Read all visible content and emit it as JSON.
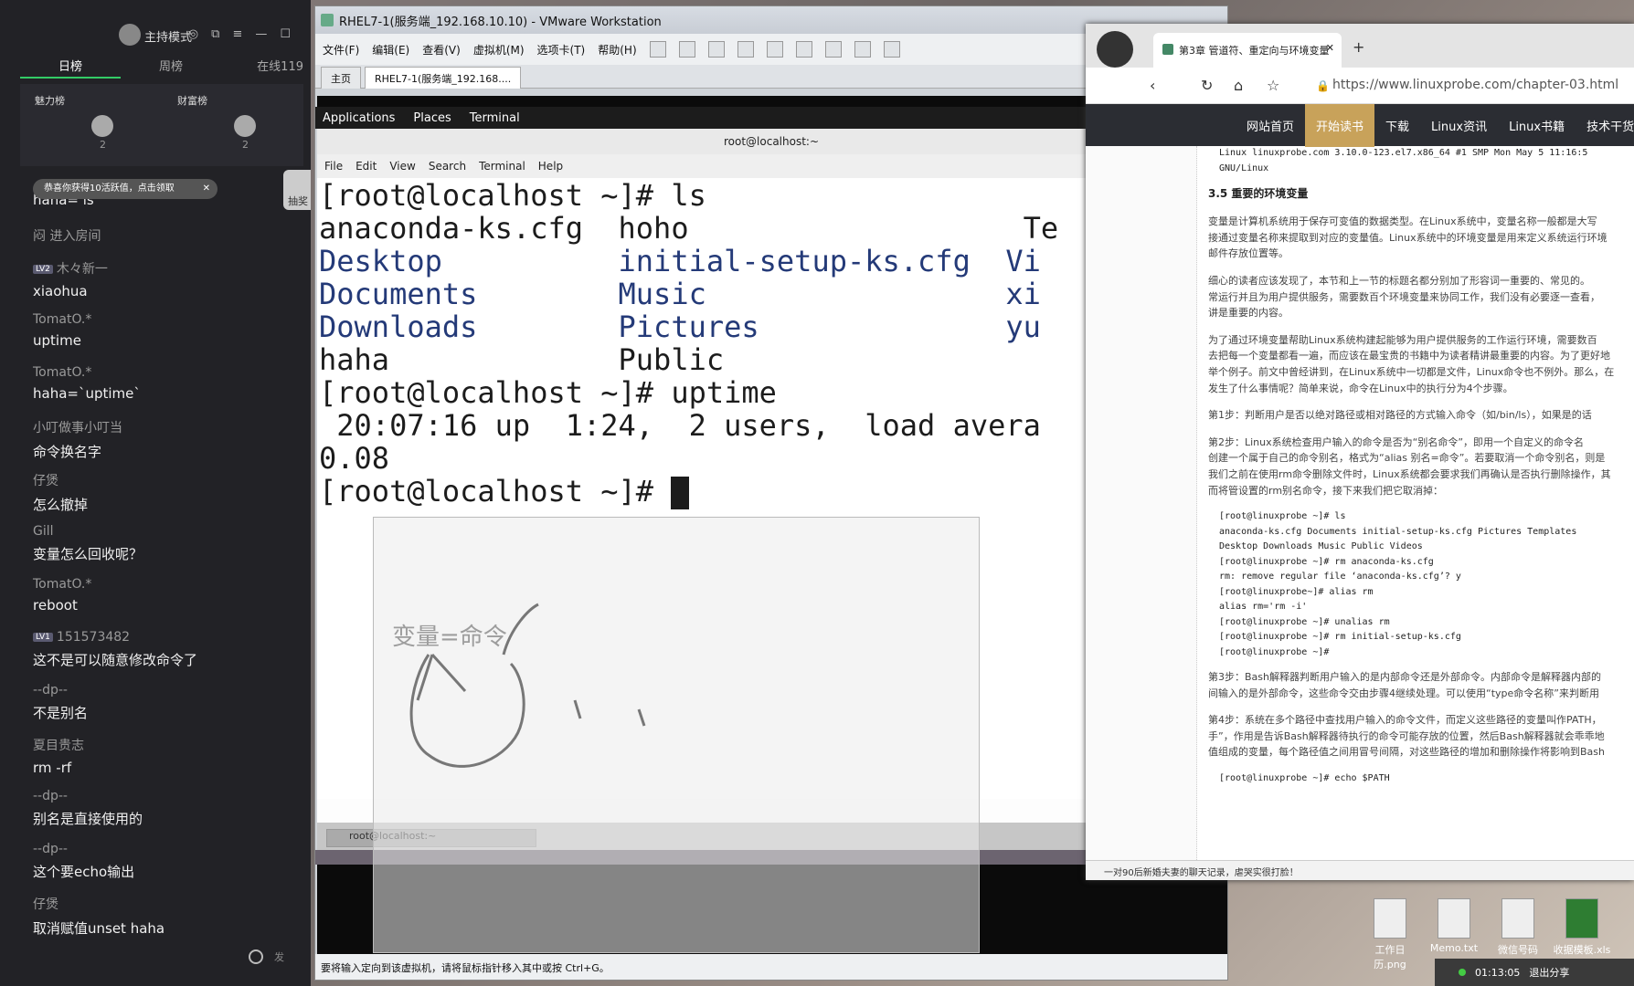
{
  "chat": {
    "host_mode": "主持模式",
    "tabs": [
      "日榜",
      "周榜"
    ],
    "online": "在线119",
    "rank_labels": [
      "魅力榜",
      "财富榜"
    ],
    "rank_counts": [
      "2",
      "2"
    ],
    "toast": "恭喜你获得10活跃值，点击领取",
    "lottery": "抽奖",
    "input_placeholder": "发",
    "messages": [
      {
        "user": "",
        "text": "haha= ls"
      },
      {
        "user": "",
        "text": "闷 进入房间"
      },
      {
        "user": "木々新一",
        "level": "LV2",
        "text": "xiaohua"
      },
      {
        "user": "TomatO.*",
        "text": "uptime"
      },
      {
        "user": "TomatO.*",
        "text": "haha=`uptime`"
      },
      {
        "user": "小叮做事小叮当",
        "text": "命令换名字"
      },
      {
        "user": "仔煲",
        "text": "怎么撤掉"
      },
      {
        "user": "Gill",
        "text": "变量怎么回收呢？"
      },
      {
        "user": "TomatO.*",
        "text": "reboot"
      },
      {
        "user": "151573482",
        "level": "LV1",
        "text": "这不是可以随意修改命令了"
      },
      {
        "user": "--dp--",
        "text": "不是别名"
      },
      {
        "user": "夏目贵志",
        "text": "rm -rf"
      },
      {
        "user": "--dp--",
        "text": "别名是直接使用的"
      },
      {
        "user": "--dp--",
        "text": "这个要echo输出"
      },
      {
        "user": "仔煲",
        "text": "取消赋值unset haha"
      }
    ]
  },
  "vmware": {
    "title": "RHEL7-1(服务端_192.168.10.10) - VMware Workstation",
    "menu": [
      "文件(F)",
      "编辑(E)",
      "查看(V)",
      "虚拟机(M)",
      "选项卡(T)",
      "帮助(H)"
    ],
    "tabs": [
      "主页",
      "RHEL7-1(服务端_192.168...."
    ],
    "status": "要将输入定向到该虚拟机，请将鼠标指针移入其中或按 Ctrl+G。"
  },
  "gnome": {
    "menus": [
      "Applications",
      "Places",
      "Terminal"
    ],
    "window_title": "root@localhost:~",
    "terminal_menu": [
      "File",
      "Edit",
      "View",
      "Search",
      "Terminal",
      "Help"
    ],
    "taskbar_item": "root@localhost:~"
  },
  "terminal": {
    "lines": [
      "[root@localhost ~]# ls",
      "anaconda-ks.cfg  hoho                   Te",
      "Desktop          initial-setup-ks.cfg  Vi",
      "Documents        Music                 xi",
      "Downloads        Pictures              yu",
      "haha             Public",
      "[root@localhost ~]# uptime",
      " 20:07:16 up  1:24,  2 users,  load avera",
      "0.08",
      "[root@localhost ~]# "
    ]
  },
  "whiteboard": {
    "text": "变量=命令"
  },
  "browser": {
    "tab_title": "第3章 管道符、重定向与环境变量",
    "url": "https://www.linuxprobe.com/chapter-03.html",
    "site_nav": [
      "网站首页",
      "开始读书",
      "下载",
      "Linux资讯",
      "Linux书籍",
      "技术干货"
    ],
    "top_lines": [
      "Linux linuxprobe.com 3.10.0-123.el7.x86_64 #1 SMP Mon May 5 11:16:5",
      "GNU/Linux"
    ],
    "heading": "3.5 重要的环境变量",
    "paragraphs": [
      "变量是计算机系统用于保存可变值的数据类型。在Linux系统中，变量名称一般都是大写",
      "接通过变量名称来提取到对应的变量值。Linux系统中的环境变量是用来定义系统运行环境",
      "邮件存放位置等。",
      "细心的读者应该发现了，本节和上一节的标题名都分别加了形容词一重要的、常见的。",
      "常运行并且为用户提供服务，需要数百个环境变量来协同工作，我们没有必要逐一查看，",
      "讲是重要的内容。",
      "为了通过环境变量帮助Linux系统构建起能够为用户提供服务的工作运行环境，需要数百",
      "去把每一个变量都看一遍，而应该在最宝贵的书籍中为读者精讲最重要的内容。为了更好地",
      "举个例子。前文中曾经讲到，在Linux系统中一切都是文件，Linux命令也不例外。那么，在",
      "发生了什么事情呢？简单来说，命令在Linux中的执行分为4个步骤。",
      "第1步：判断用户是否以绝对路径或相对路径的方式输入命令（如/bin/ls），如果是的话",
      "第2步：Linux系统检查用户输入的命令是否为“别名命令”，即用一个自定义的命令名",
      "创建一个属于自己的命令别名，格式为“alias 别名=命令”。若要取消一个命令别名，则是",
      "我们之前在使用rm命令删除文件时，Linux系统都会要求我们再确认是否执行删除操作，其",
      "而将管设置的rm别名命令，接下来我们把它取消掉："
    ],
    "code1": [
      "[root@linuxprobe ~]# ls",
      "anaconda-ks.cfg Documents initial-setup-ks.cfg Pictures Templates",
      "Desktop Downloads Music Public Videos",
      "[root@linuxprobe ~]# rm anaconda-ks.cfg",
      "rm: remove regular file ‘anaconda-ks.cfg’? y",
      "[root@linuxprobe~]# alias rm",
      "alias rm='rm -i'",
      "[root@linuxprobe ~]# unalias rm",
      "[root@linuxprobe ~]# rm initial-setup-ks.cfg",
      "[root@linuxprobe ~]#"
    ],
    "paragraphs2": [
      "第3步：Bash解释器判断用户输入的是内部命令还是外部命令。内部命令是解释器内部的",
      "间输入的是外部命令，这些命令交由步骤4继续处理。可以使用“type命令名称”来判断用",
      "第4步：系统在多个路径中查找用户输入的命令文件，而定义这些路径的变量叫作PATH，",
      "手”，作用是告诉Bash解释器待执行的命令可能存放的位置，然后Bash解释器就会乖乖地",
      "值组成的变量，每个路径值之间用冒号间隔，对这些路径的增加和删除操作将影响到Bash"
    ],
    "code2": "[root@linuxprobe ~]# echo $PATH",
    "footer": "一对90后新婚夫妻的聊天记录，虐哭实很打脸！"
  },
  "desktop_icons": [
    "工作日历.png",
    "Memo.txt",
    "微信号码",
    "收据模板.xls"
  ],
  "tray": {
    "time": "01:13:05",
    "exit_share": "退出分享"
  }
}
